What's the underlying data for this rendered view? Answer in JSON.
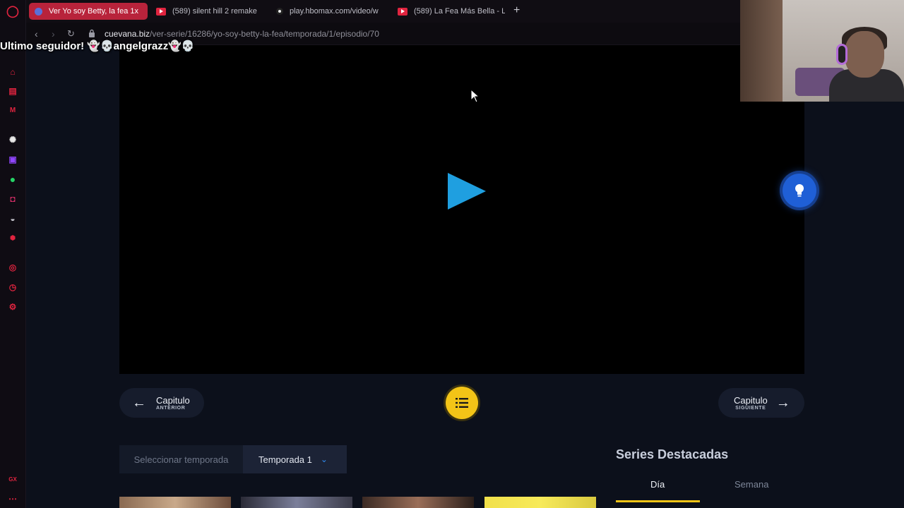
{
  "browser": {
    "tabs": [
      {
        "title": "Ver Yo soy Betty, la fea 1x",
        "active": true,
        "favicon": "cuevana-favicon"
      },
      {
        "title": "(589) silent hill 2 remake",
        "active": false,
        "favicon": "youtube-icon"
      },
      {
        "title": "play.hbomax.com/video/w",
        "active": false,
        "favicon": "hbo-icon"
      },
      {
        "title": "(589) La Fea Más Bella - L",
        "active": false,
        "favicon": "youtube-icon"
      }
    ],
    "new_tab": "+",
    "url_domain": "cuevana.biz",
    "url_path": "/ver-serie/16286/yo-soy-betty-la-fea/temporada/1/episodio/70"
  },
  "overlay": {
    "last_follower": "Ultimo seguidor! 👻💀angelgrazz👻💀"
  },
  "player": {
    "prev": {
      "label": "Capitulo",
      "sub": "ANTERIOR"
    },
    "next": {
      "label": "Capitulo",
      "sub": "SIGUIENTE"
    }
  },
  "season_selector": {
    "label": "Seleccionar temporada",
    "selected": "Temporada 1"
  },
  "featured": {
    "title": "Series Destacadas",
    "tabs": [
      {
        "label": "Día",
        "active": true
      },
      {
        "label": "Semana",
        "active": false
      }
    ]
  },
  "colors": {
    "accent": "#f3c417",
    "play": "#1f9fe0",
    "opera_red": "#e0243f"
  }
}
